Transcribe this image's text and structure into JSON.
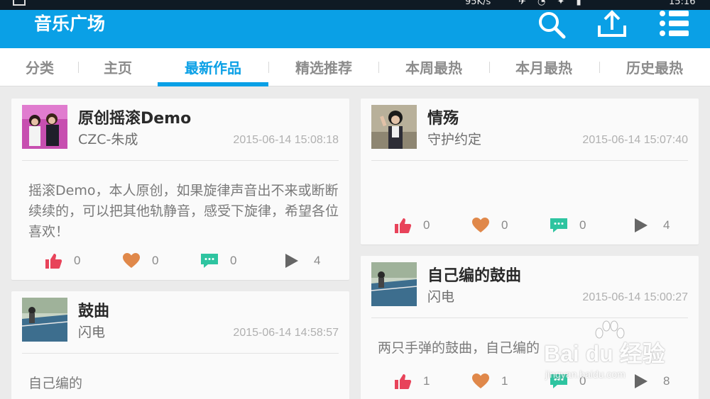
{
  "status_bar": {
    "speed": "95K/s",
    "time": "15:16"
  },
  "app_bar": {
    "title": "音乐广场",
    "icons": [
      "search-icon",
      "upload-icon",
      "menu-list-icon"
    ]
  },
  "tabs": [
    {
      "label": "分类",
      "active": false
    },
    {
      "label": "主页",
      "active": false
    },
    {
      "label": "最新作品",
      "active": true
    },
    {
      "label": "精选推荐",
      "active": false
    },
    {
      "label": "本周最热",
      "active": false
    },
    {
      "label": "本月最热",
      "active": false
    },
    {
      "label": "历史最热",
      "active": false
    }
  ],
  "cards": [
    {
      "title": "原创摇滚Demo",
      "author": "CZC-朱成",
      "time": "2015-06-14 15:08:18",
      "description": "摇滚Demo，本人原创，如果旋律声音出不来或断断续续的，可以把其他轨静音，感受下旋律，希望各位喜欢！",
      "likes": "0",
      "favorites": "0",
      "comments": "0",
      "plays": "4"
    },
    {
      "title": "情殇",
      "author": "守护约定",
      "time": "2015-06-14 15:07:40",
      "description": "",
      "likes": "0",
      "favorites": "0",
      "comments": "0",
      "plays": "4"
    },
    {
      "title": "自己编的鼓曲",
      "author": "闪电",
      "time": "2015-06-14 15:00:27",
      "description": "两只手弹的鼓曲，自己编的",
      "likes": "1",
      "favorites": "1",
      "comments": "0",
      "plays": "8"
    },
    {
      "title": "鼓曲",
      "author": "闪电",
      "time": "2015-06-14 14:58:57",
      "description": "自己编的",
      "likes": "",
      "favorites": "",
      "comments": "",
      "plays": ""
    }
  ],
  "colors": {
    "primary": "#0aa0e6",
    "like": "#e8435a",
    "favorite": "#e0884a",
    "comment": "#2ec4a0",
    "play": "#666666"
  },
  "watermark": {
    "main": "Bai du 经验",
    "sub": "jingyan.baidu.com"
  }
}
